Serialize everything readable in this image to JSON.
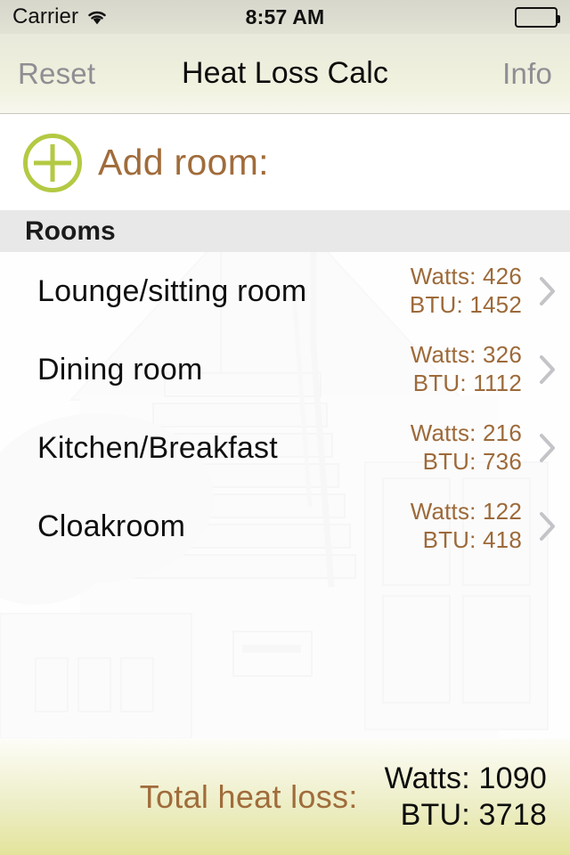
{
  "status_bar": {
    "carrier": "Carrier",
    "wifi_icon": "wifi-icon",
    "time": "8:57 AM",
    "battery_icon": "battery-full-icon"
  },
  "nav_bar": {
    "left_button": "Reset",
    "title": "Heat Loss Calc",
    "right_button": "Info"
  },
  "add_room": {
    "icon": "plus-circle-icon",
    "label": "Add room:"
  },
  "section": {
    "header": "Rooms"
  },
  "rooms": [
    {
      "name": "Lounge/sitting room",
      "watts": "Watts: 426",
      "btu": "BTU: 1452",
      "chevron": "chevron-right-icon"
    },
    {
      "name": "Dining room",
      "watts": "Watts: 326",
      "btu": "BTU: 1112",
      "chevron": "chevron-right-icon"
    },
    {
      "name": "Kitchen/Breakfast",
      "watts": "Watts: 216",
      "btu": "BTU: 736",
      "chevron": "chevron-right-icon"
    },
    {
      "name": "Cloakroom",
      "watts": "Watts: 122",
      "btu": "BTU: 418",
      "chevron": "chevron-right-icon"
    }
  ],
  "total": {
    "label": "Total heat loss:",
    "watts": "Watts: 1090",
    "btu": "BTU: 3718"
  },
  "colors": {
    "accent_green": "#b4c943",
    "accent_brown": "#a06c3b",
    "value_brown": "#9d6a3a",
    "nav_gray": "#8e8e93",
    "section_header_bg": "#e8e8e9",
    "total_bar_end": "#e3e49b",
    "chevron_gray": "#c7c7cc"
  }
}
